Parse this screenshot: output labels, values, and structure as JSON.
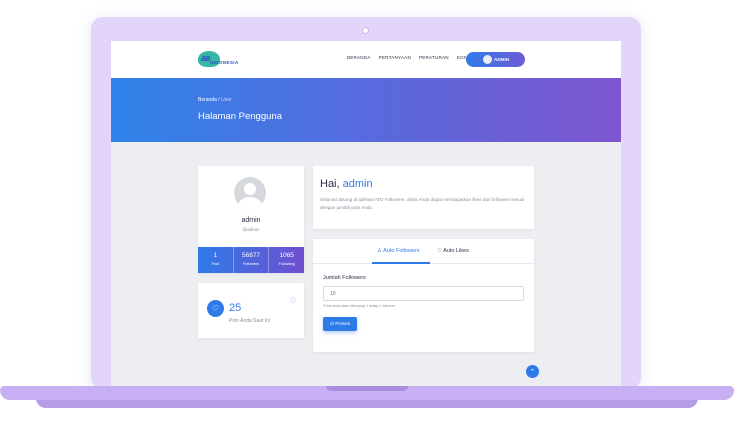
{
  "nav": {
    "logo_text": "ae",
    "logo_sub": "INDONESIA",
    "links": [
      "BERANDA",
      "PERTANYAAN",
      "PERATURAN",
      "KONTAK"
    ],
    "user_label": "ADMIN"
  },
  "hero": {
    "breadcrumb_home": "Beranda",
    "breadcrumb_sep": "/",
    "breadcrumb_current": "User",
    "title": "Halaman Pengguna"
  },
  "profile": {
    "name": "admin",
    "username": "@admin",
    "stats": [
      {
        "value": "1",
        "label": "Post"
      },
      {
        "value": "56877",
        "label": "Followers"
      },
      {
        "value": "1065",
        "label": "Following"
      }
    ]
  },
  "points": {
    "value": "25",
    "label": "Poin Anda Saat Ini"
  },
  "greeting": {
    "hello": "Hai,",
    "name": "admin",
    "message": "Selamat datang di aplikasi ATD Followers, disini Anda dapat mendapatkan likes dan followers sesuai dengan jumlah poin Anda"
  },
  "form": {
    "tab_followers": "Auto Followers",
    "tab_likes": "Auto Likes",
    "field_label": "Jumlah Followers",
    "field_value": "10",
    "hint": "*Poin anda akan dikurangi 1 setiap 1 follower",
    "button_label": "Proses"
  },
  "colors": {
    "accent": "#2f7ae9",
    "hero_start": "#2f83ea",
    "hero_end": "#7d56cf",
    "laptop_frame": "#e3d4f9"
  }
}
